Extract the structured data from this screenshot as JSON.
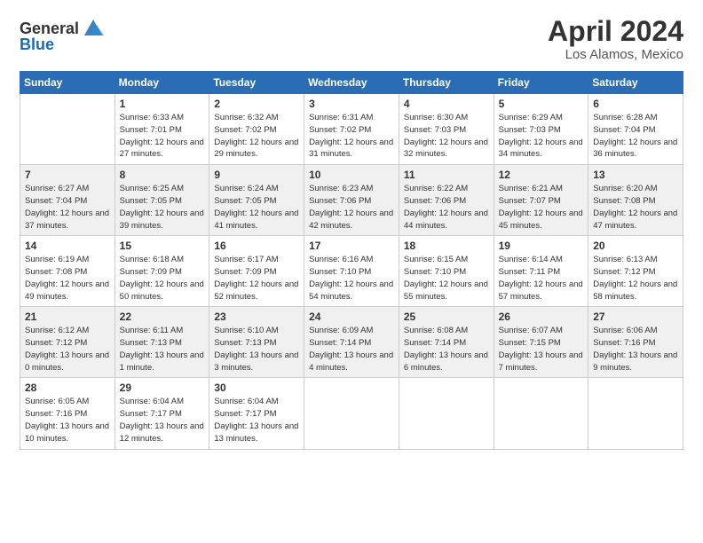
{
  "header": {
    "logo_general": "General",
    "logo_blue": "Blue",
    "month_year": "April 2024",
    "location": "Los Alamos, Mexico"
  },
  "weekdays": [
    "Sunday",
    "Monday",
    "Tuesday",
    "Wednesday",
    "Thursday",
    "Friday",
    "Saturday"
  ],
  "weeks": [
    [
      {
        "num": "",
        "sunrise": "",
        "sunset": "",
        "daylight": ""
      },
      {
        "num": "1",
        "sunrise": "Sunrise: 6:33 AM",
        "sunset": "Sunset: 7:01 PM",
        "daylight": "Daylight: 12 hours and 27 minutes."
      },
      {
        "num": "2",
        "sunrise": "Sunrise: 6:32 AM",
        "sunset": "Sunset: 7:02 PM",
        "daylight": "Daylight: 12 hours and 29 minutes."
      },
      {
        "num": "3",
        "sunrise": "Sunrise: 6:31 AM",
        "sunset": "Sunset: 7:02 PM",
        "daylight": "Daylight: 12 hours and 31 minutes."
      },
      {
        "num": "4",
        "sunrise": "Sunrise: 6:30 AM",
        "sunset": "Sunset: 7:03 PM",
        "daylight": "Daylight: 12 hours and 32 minutes."
      },
      {
        "num": "5",
        "sunrise": "Sunrise: 6:29 AM",
        "sunset": "Sunset: 7:03 PM",
        "daylight": "Daylight: 12 hours and 34 minutes."
      },
      {
        "num": "6",
        "sunrise": "Sunrise: 6:28 AM",
        "sunset": "Sunset: 7:04 PM",
        "daylight": "Daylight: 12 hours and 36 minutes."
      }
    ],
    [
      {
        "num": "7",
        "sunrise": "Sunrise: 6:27 AM",
        "sunset": "Sunset: 7:04 PM",
        "daylight": "Daylight: 12 hours and 37 minutes."
      },
      {
        "num": "8",
        "sunrise": "Sunrise: 6:25 AM",
        "sunset": "Sunset: 7:05 PM",
        "daylight": "Daylight: 12 hours and 39 minutes."
      },
      {
        "num": "9",
        "sunrise": "Sunrise: 6:24 AM",
        "sunset": "Sunset: 7:05 PM",
        "daylight": "Daylight: 12 hours and 41 minutes."
      },
      {
        "num": "10",
        "sunrise": "Sunrise: 6:23 AM",
        "sunset": "Sunset: 7:06 PM",
        "daylight": "Daylight: 12 hours and 42 minutes."
      },
      {
        "num": "11",
        "sunrise": "Sunrise: 6:22 AM",
        "sunset": "Sunset: 7:06 PM",
        "daylight": "Daylight: 12 hours and 44 minutes."
      },
      {
        "num": "12",
        "sunrise": "Sunrise: 6:21 AM",
        "sunset": "Sunset: 7:07 PM",
        "daylight": "Daylight: 12 hours and 45 minutes."
      },
      {
        "num": "13",
        "sunrise": "Sunrise: 6:20 AM",
        "sunset": "Sunset: 7:08 PM",
        "daylight": "Daylight: 12 hours and 47 minutes."
      }
    ],
    [
      {
        "num": "14",
        "sunrise": "Sunrise: 6:19 AM",
        "sunset": "Sunset: 7:08 PM",
        "daylight": "Daylight: 12 hours and 49 minutes."
      },
      {
        "num": "15",
        "sunrise": "Sunrise: 6:18 AM",
        "sunset": "Sunset: 7:09 PM",
        "daylight": "Daylight: 12 hours and 50 minutes."
      },
      {
        "num": "16",
        "sunrise": "Sunrise: 6:17 AM",
        "sunset": "Sunset: 7:09 PM",
        "daylight": "Daylight: 12 hours and 52 minutes."
      },
      {
        "num": "17",
        "sunrise": "Sunrise: 6:16 AM",
        "sunset": "Sunset: 7:10 PM",
        "daylight": "Daylight: 12 hours and 54 minutes."
      },
      {
        "num": "18",
        "sunrise": "Sunrise: 6:15 AM",
        "sunset": "Sunset: 7:10 PM",
        "daylight": "Daylight: 12 hours and 55 minutes."
      },
      {
        "num": "19",
        "sunrise": "Sunrise: 6:14 AM",
        "sunset": "Sunset: 7:11 PM",
        "daylight": "Daylight: 12 hours and 57 minutes."
      },
      {
        "num": "20",
        "sunrise": "Sunrise: 6:13 AM",
        "sunset": "Sunset: 7:12 PM",
        "daylight": "Daylight: 12 hours and 58 minutes."
      }
    ],
    [
      {
        "num": "21",
        "sunrise": "Sunrise: 6:12 AM",
        "sunset": "Sunset: 7:12 PM",
        "daylight": "Daylight: 13 hours and 0 minutes."
      },
      {
        "num": "22",
        "sunrise": "Sunrise: 6:11 AM",
        "sunset": "Sunset: 7:13 PM",
        "daylight": "Daylight: 13 hours and 1 minute."
      },
      {
        "num": "23",
        "sunrise": "Sunrise: 6:10 AM",
        "sunset": "Sunset: 7:13 PM",
        "daylight": "Daylight: 13 hours and 3 minutes."
      },
      {
        "num": "24",
        "sunrise": "Sunrise: 6:09 AM",
        "sunset": "Sunset: 7:14 PM",
        "daylight": "Daylight: 13 hours and 4 minutes."
      },
      {
        "num": "25",
        "sunrise": "Sunrise: 6:08 AM",
        "sunset": "Sunset: 7:14 PM",
        "daylight": "Daylight: 13 hours and 6 minutes."
      },
      {
        "num": "26",
        "sunrise": "Sunrise: 6:07 AM",
        "sunset": "Sunset: 7:15 PM",
        "daylight": "Daylight: 13 hours and 7 minutes."
      },
      {
        "num": "27",
        "sunrise": "Sunrise: 6:06 AM",
        "sunset": "Sunset: 7:16 PM",
        "daylight": "Daylight: 13 hours and 9 minutes."
      }
    ],
    [
      {
        "num": "28",
        "sunrise": "Sunrise: 6:05 AM",
        "sunset": "Sunset: 7:16 PM",
        "daylight": "Daylight: 13 hours and 10 minutes."
      },
      {
        "num": "29",
        "sunrise": "Sunrise: 6:04 AM",
        "sunset": "Sunset: 7:17 PM",
        "daylight": "Daylight: 13 hours and 12 minutes."
      },
      {
        "num": "30",
        "sunrise": "Sunrise: 6:04 AM",
        "sunset": "Sunset: 7:17 PM",
        "daylight": "Daylight: 13 hours and 13 minutes."
      },
      {
        "num": "",
        "sunrise": "",
        "sunset": "",
        "daylight": ""
      },
      {
        "num": "",
        "sunrise": "",
        "sunset": "",
        "daylight": ""
      },
      {
        "num": "",
        "sunrise": "",
        "sunset": "",
        "daylight": ""
      },
      {
        "num": "",
        "sunrise": "",
        "sunset": "",
        "daylight": ""
      }
    ]
  ]
}
